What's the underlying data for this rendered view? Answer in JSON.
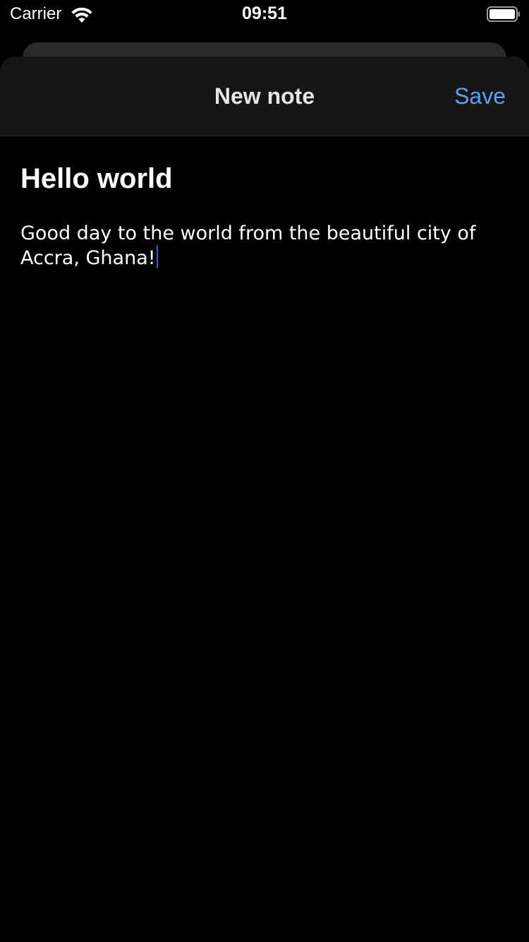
{
  "status_bar": {
    "carrier": "Carrier",
    "time": "09:51",
    "wifi_icon": "wifi-icon",
    "battery_icon": "battery-full-icon"
  },
  "nav": {
    "title": "New note",
    "save_label": "Save",
    "save_color": "#5aa1f2"
  },
  "note": {
    "title": "Hello world",
    "body": "Good day to the world from the beautiful city of Accra, Ghana!"
  },
  "colors": {
    "background": "#000000",
    "nav_background": "#161617",
    "cursor": "#2f5fd6"
  }
}
